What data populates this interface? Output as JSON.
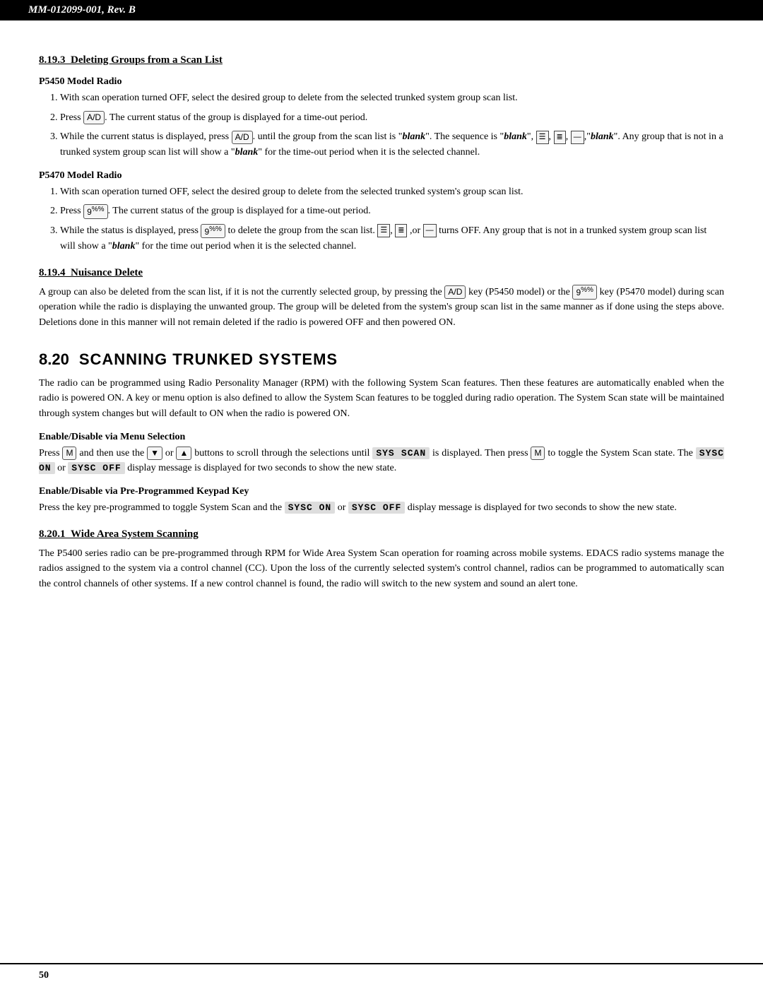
{
  "header": {
    "label": "MM-012099-001, Rev. B"
  },
  "footer": {
    "page_number": "50"
  },
  "section_819": {
    "sub3": {
      "number": "8.19.3",
      "title": "Deleting Groups from a Scan List",
      "p5450_heading": "P5450 Model Radio",
      "p5450_steps": [
        "With scan operation turned OFF, select the desired group to delete from the selected trunked system group scan list.",
        "Press [A/D]. The current status of the group is displayed for a time-out period.",
        "While the current status is displayed, press [A/D]. until the group from the scan list is \"blank\". The sequence is \"blank\", [III], [II], [I], \"blank\". Any group that is not in a trunked system group scan list will show a \"blank\" for the time-out period when it is the selected channel."
      ],
      "p5470_heading": "P5470 Model Radio",
      "p5470_steps": [
        "With scan operation turned OFF, select the desired group to delete from the selected trunked system's group scan list.",
        "Press [9%%]. The current status of the group is displayed for a time-out period.",
        "While the status is displayed, press [9%%] to delete the group from the scan list. [III], [II] ,or [I] turns OFF. Any group that is not in a trunked system group scan list will show a \"blank\" for the time out period when it is the selected channel."
      ]
    },
    "sub4": {
      "number": "8.19.4",
      "title": "Nuisance Delete",
      "body": "A group can also be deleted from the scan list, if it is not the currently selected group, by pressing the [A/D] key (P5450 model) or the [9%%] key (P5470 model) during scan operation while the radio is displaying the unwanted group. The group will be deleted from the system's group scan list in the same manner as if done using the steps above. Deletions done in this manner will not remain deleted if the radio is powered OFF and then powered ON."
    }
  },
  "section_820": {
    "number": "8.20",
    "title": "SCANNING TRUNKED SYSTEMS",
    "intro": "The radio can be programmed using Radio Personality Manager (RPM) with the following System Scan features. Then these features are automatically enabled when the radio is powered ON. A key or menu option is also defined to allow the System Scan features to be toggled during radio operation. The System Scan state will be maintained through system changes but will default to ON when the radio is powered ON.",
    "enable_menu": {
      "heading": "Enable/Disable via Menu Selection",
      "body": "Press [M] and then use the [▼] or [▲] buttons to scroll through the selections until SYS SCAN is displayed. Then press [M] to toggle the System Scan state. The SYSC ON or SYSC OFF display message is displayed for two seconds to show the new state."
    },
    "enable_keypad": {
      "heading": "Enable/Disable via Pre-Programmed Keypad Key",
      "body": "Press the key pre-programmed to toggle System Scan and the SYSC ON or SYSC OFF display message is displayed for two seconds to show the new state."
    },
    "sub1": {
      "number": "8.20.1",
      "title": "Wide Area System Scanning",
      "body": "The P5400 series radio can be pre-programmed through RPM for Wide Area System Scan operation for roaming across mobile systems. EDACS radio systems manage the radios assigned to the system via a control channel (CC). Upon the loss of the currently selected system's control channel, radios can be programmed to automatically scan the control channels of other systems. If a new control channel is found, the radio will switch to the new system and sound an alert tone."
    }
  }
}
